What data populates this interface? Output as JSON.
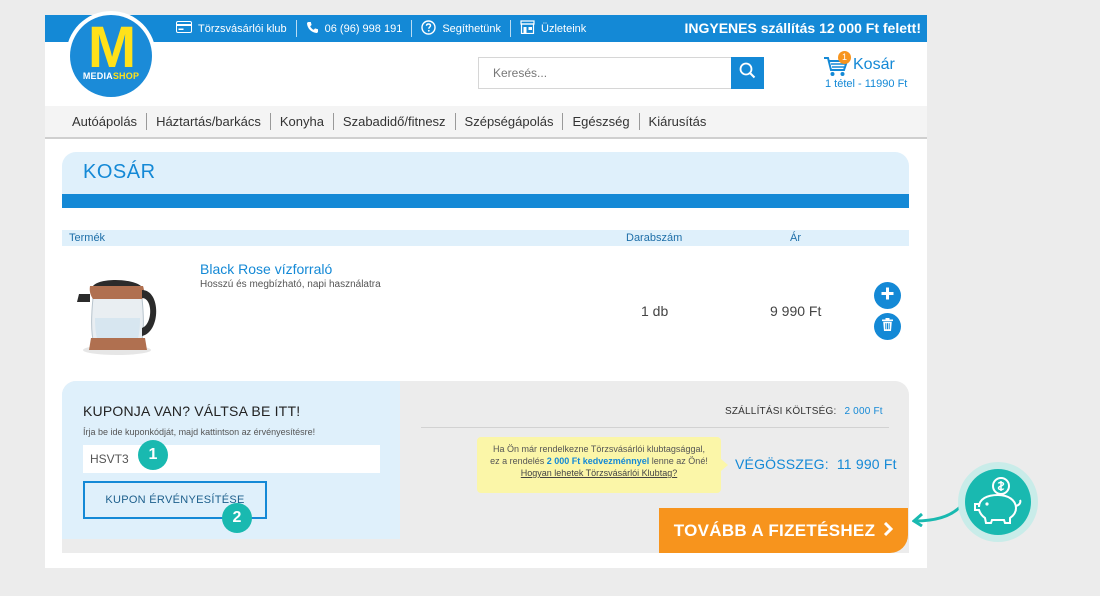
{
  "topbar": {
    "links": [
      {
        "label": "Törzsvásárlói klub",
        "icon": "card-icon"
      },
      {
        "label": "06 (96) 998 191",
        "icon": "phone-icon"
      },
      {
        "label": "Segíthetünk",
        "icon": "help-icon"
      },
      {
        "label": "Üzleteink",
        "icon": "store-icon"
      }
    ],
    "promo": "INGYENES szállítás 12 000 Ft felett!",
    "color": "#1489d6"
  },
  "logo": {
    "letter": "M",
    "sub_a": "MEDIA",
    "sub_b": "SHOP"
  },
  "search": {
    "placeholder": "Keresés..."
  },
  "cart": {
    "label": "Kosár",
    "badge": "1",
    "summary": "1 tétel - 11990 Ft"
  },
  "nav": [
    "Autóápolás",
    "Háztartás/barkács",
    "Konyha",
    "Szabadidő/fitnesz",
    "Szépségápolás",
    "Egészség",
    "Kiárusítás"
  ],
  "page_title": "KOSÁR",
  "table": {
    "headers": {
      "product": "Termék",
      "qty": "Darabszám",
      "price": "Ár"
    },
    "rows": [
      {
        "name": "Black Rose vízforraló",
        "desc": "Hosszú és megbízható, napi használatra",
        "qty": "1 db",
        "price": "9 990 Ft"
      }
    ]
  },
  "coupon": {
    "title": "KUPONJA VAN? VÁLTSA BE ITT!",
    "hint": "Írja be ide kuponkódját, majd kattintson az érvényesítésre!",
    "value": "HSVT3",
    "button": "KUPON ÉRVÉNYESÍTÉSE",
    "step1": "1",
    "step2": "2"
  },
  "summary": {
    "shipping_label": "SZÁLLÍTÁSI KÖLTSÉG:",
    "shipping_value": "2 000 Ft",
    "club_line1": "Ha Ön már rendelkezne Törzsvásárlói klubtagsággal,",
    "club_line2a": "ez a rendelés ",
    "club_bold": "2 000 Ft kedvezménnyel",
    "club_line2b": " lenne az Öné!",
    "club_link": "Hogyan lehetek Törzsvásárlói Klubtag?",
    "total_label": "VÉGÖSSZEG:",
    "total_value": "11 990 Ft"
  },
  "checkout": {
    "label": "TOVÁBB A FIZETÉSHEZ",
    "color": "#f7941d"
  },
  "accent": {
    "teal": "#19b9b0"
  }
}
